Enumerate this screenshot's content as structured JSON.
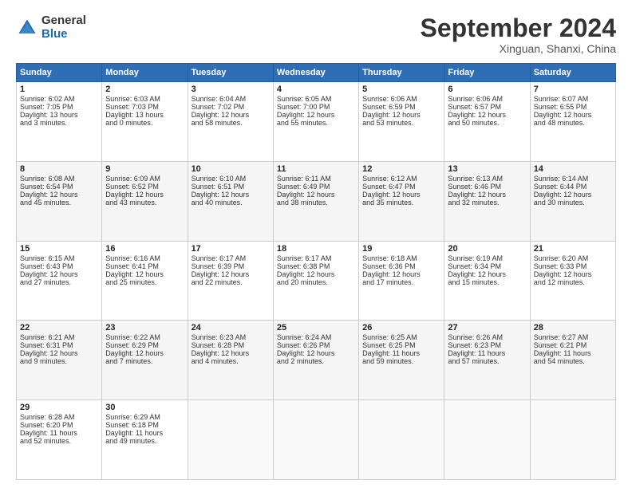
{
  "header": {
    "logo_general": "General",
    "logo_blue": "Blue",
    "month_title": "September 2024",
    "location": "Xinguan, Shanxi, China"
  },
  "days_header": [
    "Sunday",
    "Monday",
    "Tuesday",
    "Wednesday",
    "Thursday",
    "Friday",
    "Saturday"
  ],
  "weeks": [
    [
      {
        "day": "1",
        "lines": [
          "Sunrise: 6:02 AM",
          "Sunset: 7:05 PM",
          "Daylight: 13 hours",
          "and 3 minutes."
        ]
      },
      {
        "day": "2",
        "lines": [
          "Sunrise: 6:03 AM",
          "Sunset: 7:03 PM",
          "Daylight: 13 hours",
          "and 0 minutes."
        ]
      },
      {
        "day": "3",
        "lines": [
          "Sunrise: 6:04 AM",
          "Sunset: 7:02 PM",
          "Daylight: 12 hours",
          "and 58 minutes."
        ]
      },
      {
        "day": "4",
        "lines": [
          "Sunrise: 6:05 AM",
          "Sunset: 7:00 PM",
          "Daylight: 12 hours",
          "and 55 minutes."
        ]
      },
      {
        "day": "5",
        "lines": [
          "Sunrise: 6:06 AM",
          "Sunset: 6:59 PM",
          "Daylight: 12 hours",
          "and 53 minutes."
        ]
      },
      {
        "day": "6",
        "lines": [
          "Sunrise: 6:06 AM",
          "Sunset: 6:57 PM",
          "Daylight: 12 hours",
          "and 50 minutes."
        ]
      },
      {
        "day": "7",
        "lines": [
          "Sunrise: 6:07 AM",
          "Sunset: 6:55 PM",
          "Daylight: 12 hours",
          "and 48 minutes."
        ]
      }
    ],
    [
      {
        "day": "8",
        "lines": [
          "Sunrise: 6:08 AM",
          "Sunset: 6:54 PM",
          "Daylight: 12 hours",
          "and 45 minutes."
        ]
      },
      {
        "day": "9",
        "lines": [
          "Sunrise: 6:09 AM",
          "Sunset: 6:52 PM",
          "Daylight: 12 hours",
          "and 43 minutes."
        ]
      },
      {
        "day": "10",
        "lines": [
          "Sunrise: 6:10 AM",
          "Sunset: 6:51 PM",
          "Daylight: 12 hours",
          "and 40 minutes."
        ]
      },
      {
        "day": "11",
        "lines": [
          "Sunrise: 6:11 AM",
          "Sunset: 6:49 PM",
          "Daylight: 12 hours",
          "and 38 minutes."
        ]
      },
      {
        "day": "12",
        "lines": [
          "Sunrise: 6:12 AM",
          "Sunset: 6:47 PM",
          "Daylight: 12 hours",
          "and 35 minutes."
        ]
      },
      {
        "day": "13",
        "lines": [
          "Sunrise: 6:13 AM",
          "Sunset: 6:46 PM",
          "Daylight: 12 hours",
          "and 32 minutes."
        ]
      },
      {
        "day": "14",
        "lines": [
          "Sunrise: 6:14 AM",
          "Sunset: 6:44 PM",
          "Daylight: 12 hours",
          "and 30 minutes."
        ]
      }
    ],
    [
      {
        "day": "15",
        "lines": [
          "Sunrise: 6:15 AM",
          "Sunset: 6:43 PM",
          "Daylight: 12 hours",
          "and 27 minutes."
        ]
      },
      {
        "day": "16",
        "lines": [
          "Sunrise: 6:16 AM",
          "Sunset: 6:41 PM",
          "Daylight: 12 hours",
          "and 25 minutes."
        ]
      },
      {
        "day": "17",
        "lines": [
          "Sunrise: 6:17 AM",
          "Sunset: 6:39 PM",
          "Daylight: 12 hours",
          "and 22 minutes."
        ]
      },
      {
        "day": "18",
        "lines": [
          "Sunrise: 6:17 AM",
          "Sunset: 6:38 PM",
          "Daylight: 12 hours",
          "and 20 minutes."
        ]
      },
      {
        "day": "19",
        "lines": [
          "Sunrise: 6:18 AM",
          "Sunset: 6:36 PM",
          "Daylight: 12 hours",
          "and 17 minutes."
        ]
      },
      {
        "day": "20",
        "lines": [
          "Sunrise: 6:19 AM",
          "Sunset: 6:34 PM",
          "Daylight: 12 hours",
          "and 15 minutes."
        ]
      },
      {
        "day": "21",
        "lines": [
          "Sunrise: 6:20 AM",
          "Sunset: 6:33 PM",
          "Daylight: 12 hours",
          "and 12 minutes."
        ]
      }
    ],
    [
      {
        "day": "22",
        "lines": [
          "Sunrise: 6:21 AM",
          "Sunset: 6:31 PM",
          "Daylight: 12 hours",
          "and 9 minutes."
        ]
      },
      {
        "day": "23",
        "lines": [
          "Sunrise: 6:22 AM",
          "Sunset: 6:29 PM",
          "Daylight: 12 hours",
          "and 7 minutes."
        ]
      },
      {
        "day": "24",
        "lines": [
          "Sunrise: 6:23 AM",
          "Sunset: 6:28 PM",
          "Daylight: 12 hours",
          "and 4 minutes."
        ]
      },
      {
        "day": "25",
        "lines": [
          "Sunrise: 6:24 AM",
          "Sunset: 6:26 PM",
          "Daylight: 12 hours",
          "and 2 minutes."
        ]
      },
      {
        "day": "26",
        "lines": [
          "Sunrise: 6:25 AM",
          "Sunset: 6:25 PM",
          "Daylight: 11 hours",
          "and 59 minutes."
        ]
      },
      {
        "day": "27",
        "lines": [
          "Sunrise: 6:26 AM",
          "Sunset: 6:23 PM",
          "Daylight: 11 hours",
          "and 57 minutes."
        ]
      },
      {
        "day": "28",
        "lines": [
          "Sunrise: 6:27 AM",
          "Sunset: 6:21 PM",
          "Daylight: 11 hours",
          "and 54 minutes."
        ]
      }
    ],
    [
      {
        "day": "29",
        "lines": [
          "Sunrise: 6:28 AM",
          "Sunset: 6:20 PM",
          "Daylight: 11 hours",
          "and 52 minutes."
        ]
      },
      {
        "day": "30",
        "lines": [
          "Sunrise: 6:29 AM",
          "Sunset: 6:18 PM",
          "Daylight: 11 hours",
          "and 49 minutes."
        ]
      },
      null,
      null,
      null,
      null,
      null
    ]
  ]
}
